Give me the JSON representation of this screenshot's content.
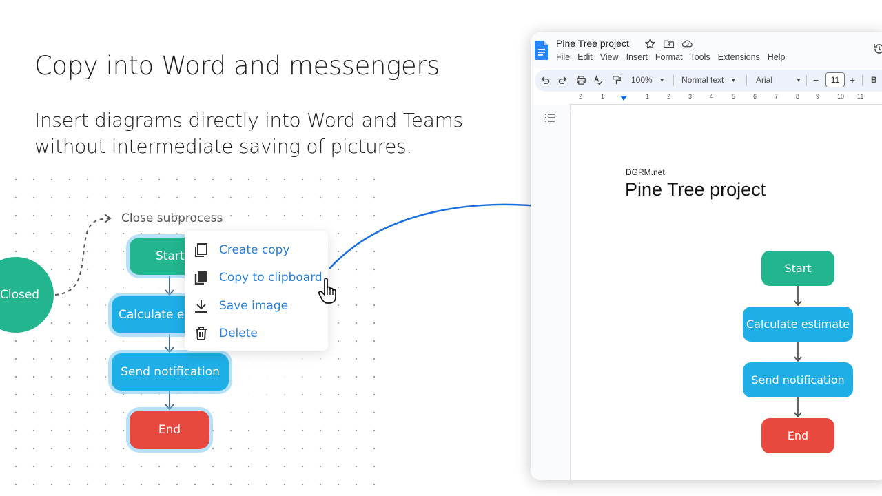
{
  "slide": {
    "headline": "Copy into Word and messengers",
    "subline": "Insert diagrams directly into Word and Teams without intermediate saving of pictures."
  },
  "canvas": {
    "closed_node": "Closed",
    "subprocess_label": "Close subprocess",
    "nodes": {
      "start": "Start",
      "calculate": "Calculate estimate",
      "send": "Send notification",
      "end": "End"
    },
    "context_menu": {
      "create_copy": "Create copy",
      "copy_clipboard": "Copy to clipboard",
      "save_image": "Save image",
      "delete": "Delete"
    }
  },
  "docs": {
    "title": "Pine Tree project",
    "menu": [
      "File",
      "Edit",
      "View",
      "Insert",
      "Format",
      "Tools",
      "Extensions",
      "Help"
    ],
    "toolbar": {
      "zoom": "100%",
      "style": "Normal text",
      "font": "Arial",
      "font_size": "11",
      "bold": "B",
      "minus": "−",
      "plus": "+"
    },
    "ruler_numbers": [
      "2",
      "1",
      "1",
      "2",
      "3",
      "4",
      "5",
      "6",
      "7",
      "8",
      "9",
      "10",
      "11"
    ],
    "document": {
      "small_text": "DGRM.net",
      "heading": "Pine Tree project",
      "diagram": {
        "start": "Start",
        "calculate": "Calculate estimate",
        "send": "Send notification",
        "end": "End"
      }
    }
  },
  "colors": {
    "green": "#22b58e",
    "blue": "#1faee6",
    "red": "#e8493e",
    "menu_text": "#2a7fd4",
    "arrow": "#1a6fe0"
  },
  "icons": [
    "copy-icon",
    "clipboard-icon",
    "download-icon",
    "trash-icon",
    "hand-cursor-icon",
    "docs-logo-icon",
    "star-icon",
    "folder-icon",
    "cloud-icon",
    "history-icon",
    "undo-icon",
    "redo-icon",
    "print-icon",
    "spellcheck-icon",
    "paint-format-icon",
    "outline-icon"
  ]
}
